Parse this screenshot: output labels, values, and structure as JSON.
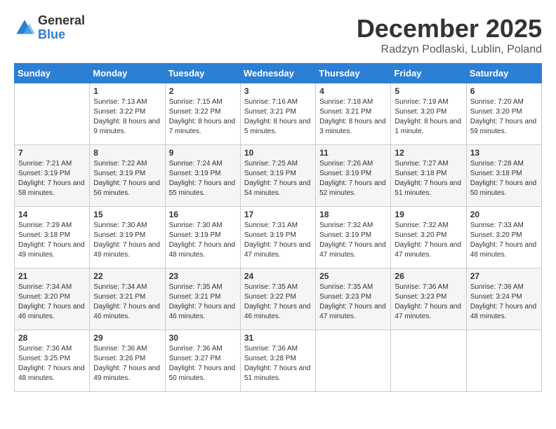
{
  "logo": {
    "general": "General",
    "blue": "Blue"
  },
  "title": "December 2025",
  "location": "Radzyn Podlaski, Lublin, Poland",
  "days_of_week": [
    "Sunday",
    "Monday",
    "Tuesday",
    "Wednesday",
    "Thursday",
    "Friday",
    "Saturday"
  ],
  "weeks": [
    [
      {
        "day": "",
        "sunrise": "",
        "sunset": "",
        "daylight": ""
      },
      {
        "day": "1",
        "sunrise": "7:13 AM",
        "sunset": "3:22 PM",
        "daylight": "8 hours and 9 minutes."
      },
      {
        "day": "2",
        "sunrise": "7:15 AM",
        "sunset": "3:22 PM",
        "daylight": "8 hours and 7 minutes."
      },
      {
        "day": "3",
        "sunrise": "7:16 AM",
        "sunset": "3:21 PM",
        "daylight": "8 hours and 5 minutes."
      },
      {
        "day": "4",
        "sunrise": "7:18 AM",
        "sunset": "3:21 PM",
        "daylight": "8 hours and 3 minutes."
      },
      {
        "day": "5",
        "sunrise": "7:19 AM",
        "sunset": "3:20 PM",
        "daylight": "8 hours and 1 minute."
      },
      {
        "day": "6",
        "sunrise": "7:20 AM",
        "sunset": "3:20 PM",
        "daylight": "7 hours and 59 minutes."
      }
    ],
    [
      {
        "day": "7",
        "sunrise": "7:21 AM",
        "sunset": "3:19 PM",
        "daylight": "7 hours and 58 minutes."
      },
      {
        "day": "8",
        "sunrise": "7:22 AM",
        "sunset": "3:19 PM",
        "daylight": "7 hours and 56 minutes."
      },
      {
        "day": "9",
        "sunrise": "7:24 AM",
        "sunset": "3:19 PM",
        "daylight": "7 hours and 55 minutes."
      },
      {
        "day": "10",
        "sunrise": "7:25 AM",
        "sunset": "3:19 PM",
        "daylight": "7 hours and 54 minutes."
      },
      {
        "day": "11",
        "sunrise": "7:26 AM",
        "sunset": "3:19 PM",
        "daylight": "7 hours and 52 minutes."
      },
      {
        "day": "12",
        "sunrise": "7:27 AM",
        "sunset": "3:18 PM",
        "daylight": "7 hours and 51 minutes."
      },
      {
        "day": "13",
        "sunrise": "7:28 AM",
        "sunset": "3:18 PM",
        "daylight": "7 hours and 50 minutes."
      }
    ],
    [
      {
        "day": "14",
        "sunrise": "7:29 AM",
        "sunset": "3:18 PM",
        "daylight": "7 hours and 49 minutes."
      },
      {
        "day": "15",
        "sunrise": "7:30 AM",
        "sunset": "3:19 PM",
        "daylight": "7 hours and 49 minutes."
      },
      {
        "day": "16",
        "sunrise": "7:30 AM",
        "sunset": "3:19 PM",
        "daylight": "7 hours and 48 minutes."
      },
      {
        "day": "17",
        "sunrise": "7:31 AM",
        "sunset": "3:19 PM",
        "daylight": "7 hours and 47 minutes."
      },
      {
        "day": "18",
        "sunrise": "7:32 AM",
        "sunset": "3:19 PM",
        "daylight": "7 hours and 47 minutes."
      },
      {
        "day": "19",
        "sunrise": "7:32 AM",
        "sunset": "3:20 PM",
        "daylight": "7 hours and 47 minutes."
      },
      {
        "day": "20",
        "sunrise": "7:33 AM",
        "sunset": "3:20 PM",
        "daylight": "7 hours and 46 minutes."
      }
    ],
    [
      {
        "day": "21",
        "sunrise": "7:34 AM",
        "sunset": "3:20 PM",
        "daylight": "7 hours and 46 minutes."
      },
      {
        "day": "22",
        "sunrise": "7:34 AM",
        "sunset": "3:21 PM",
        "daylight": "7 hours and 46 minutes."
      },
      {
        "day": "23",
        "sunrise": "7:35 AM",
        "sunset": "3:21 PM",
        "daylight": "7 hours and 46 minutes."
      },
      {
        "day": "24",
        "sunrise": "7:35 AM",
        "sunset": "3:22 PM",
        "daylight": "7 hours and 46 minutes."
      },
      {
        "day": "25",
        "sunrise": "7:35 AM",
        "sunset": "3:23 PM",
        "daylight": "7 hours and 47 minutes."
      },
      {
        "day": "26",
        "sunrise": "7:36 AM",
        "sunset": "3:23 PM",
        "daylight": "7 hours and 47 minutes."
      },
      {
        "day": "27",
        "sunrise": "7:36 AM",
        "sunset": "3:24 PM",
        "daylight": "7 hours and 48 minutes."
      }
    ],
    [
      {
        "day": "28",
        "sunrise": "7:36 AM",
        "sunset": "3:25 PM",
        "daylight": "7 hours and 48 minutes."
      },
      {
        "day": "29",
        "sunrise": "7:36 AM",
        "sunset": "3:26 PM",
        "daylight": "7 hours and 49 minutes."
      },
      {
        "day": "30",
        "sunrise": "7:36 AM",
        "sunset": "3:27 PM",
        "daylight": "7 hours and 50 minutes."
      },
      {
        "day": "31",
        "sunrise": "7:36 AM",
        "sunset": "3:28 PM",
        "daylight": "7 hours and 51 minutes."
      },
      {
        "day": "",
        "sunrise": "",
        "sunset": "",
        "daylight": ""
      },
      {
        "day": "",
        "sunrise": "",
        "sunset": "",
        "daylight": ""
      },
      {
        "day": "",
        "sunrise": "",
        "sunset": "",
        "daylight": ""
      }
    ]
  ]
}
